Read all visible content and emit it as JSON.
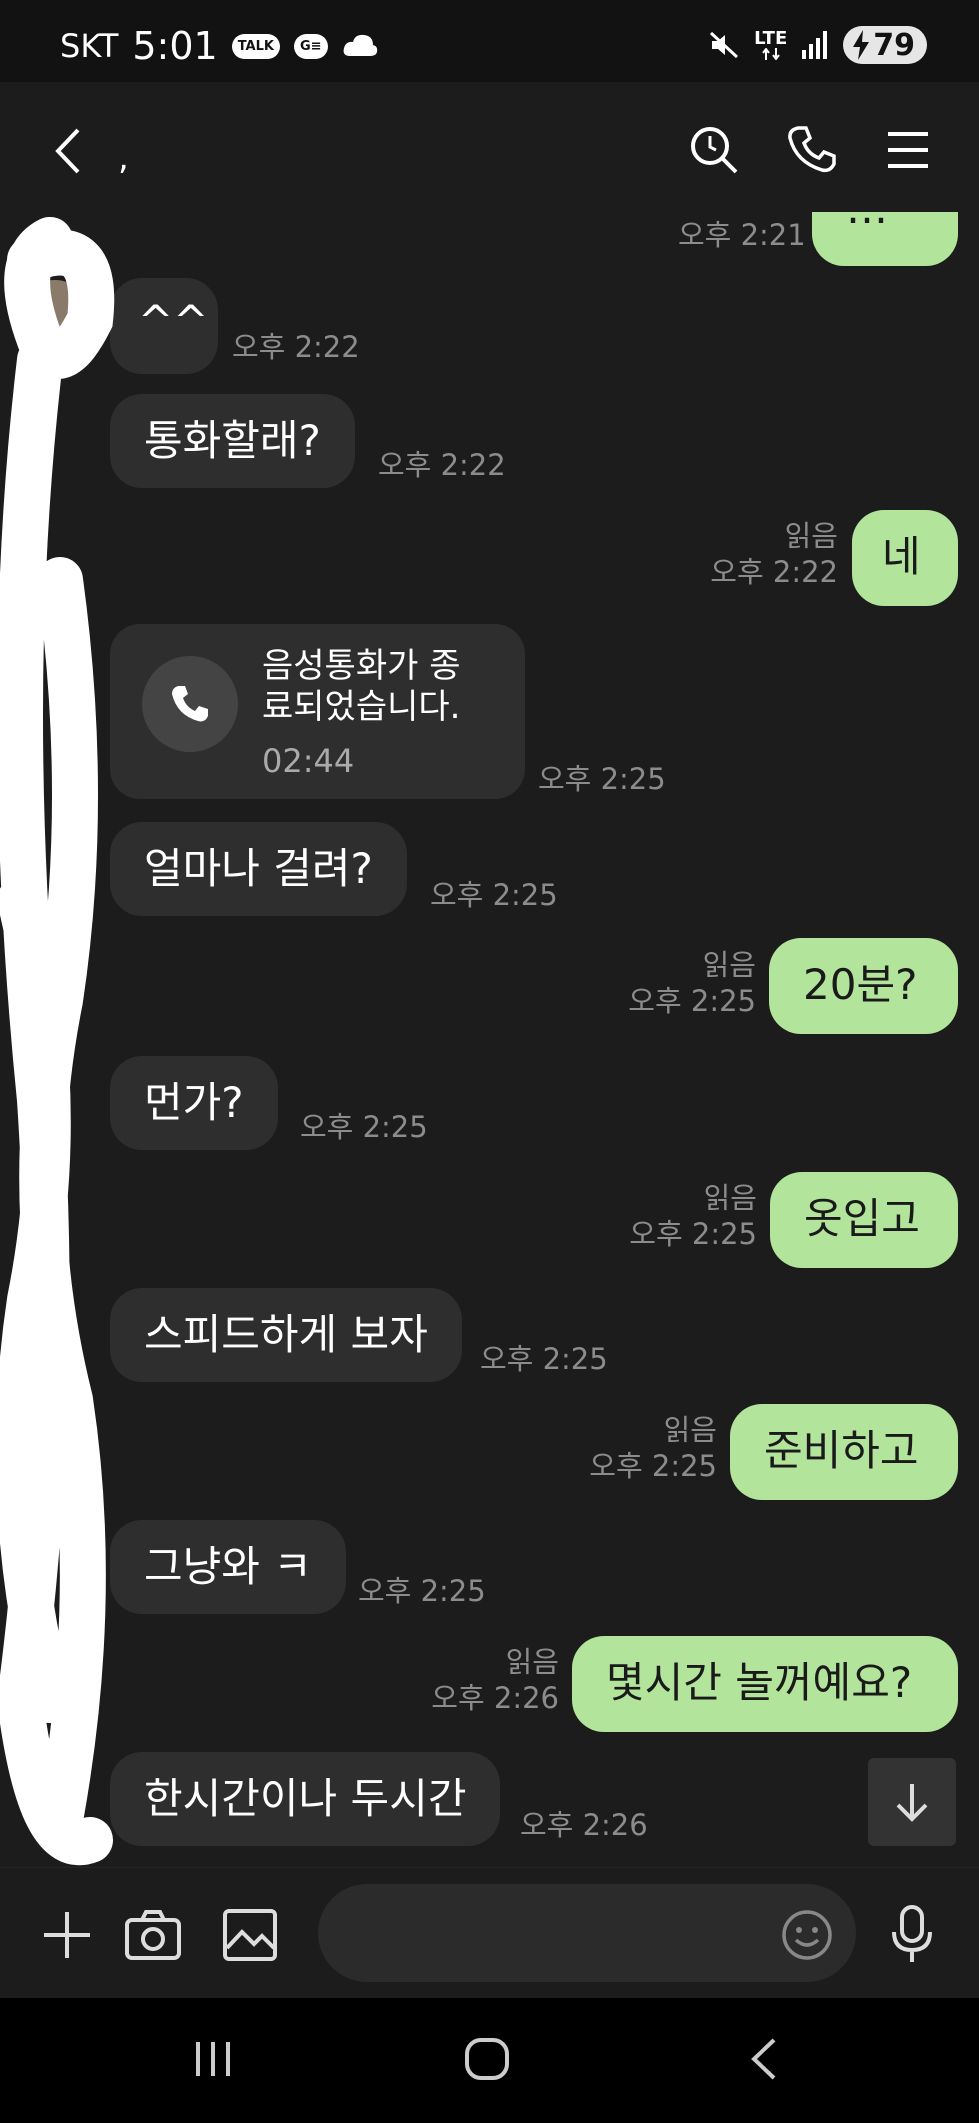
{
  "status_bar": {
    "carrier": "SKT",
    "time": "5:01",
    "notif_talk": "TALK",
    "notif_ge": "G≡",
    "network": "LTE",
    "battery": "79"
  },
  "header": {
    "title": ","
  },
  "messages": [
    {
      "dir": "out",
      "text": "…",
      "time": "오후 2:21"
    },
    {
      "dir": "in",
      "text": "^^",
      "time": "오후 2:22"
    },
    {
      "dir": "in",
      "text": "통화할래?",
      "time": "오후 2:22"
    },
    {
      "dir": "out",
      "text": "네",
      "read": "읽음",
      "time": "오후 2:22"
    },
    {
      "dir": "in",
      "type": "call",
      "text": "음성통화가 종\n료되었습니다.",
      "duration": "02:44",
      "time": "오후 2:25"
    },
    {
      "dir": "in",
      "text": "얼마나 걸려?",
      "time": "오후 2:25"
    },
    {
      "dir": "out",
      "text": "20분?",
      "read": "읽음",
      "time": "오후 2:25"
    },
    {
      "dir": "in",
      "text": "먼가?",
      "time": "오후 2:25"
    },
    {
      "dir": "out",
      "text": "옷입고",
      "read": "읽음",
      "time": "오후 2:25"
    },
    {
      "dir": "in",
      "text": "스피드하게 보자",
      "time": "오후 2:25"
    },
    {
      "dir": "out",
      "text": "준비하고",
      "read": "읽음",
      "time": "오후 2:25"
    },
    {
      "dir": "in",
      "text": "그냥와 ㅋ",
      "time": "오후 2:25"
    },
    {
      "dir": "out",
      "text": "몇시간 놀꺼예요?",
      "read": "읽음",
      "time": "오후 2:26"
    },
    {
      "dir": "in",
      "text": "한시간이나 두시간",
      "time": "오후 2:26"
    }
  ],
  "input": {
    "placeholder": ""
  },
  "colors": {
    "outgoing_bubble": "#b2e49b",
    "incoming_bubble": "#2e2e2e",
    "background": "#1c1c1c"
  }
}
